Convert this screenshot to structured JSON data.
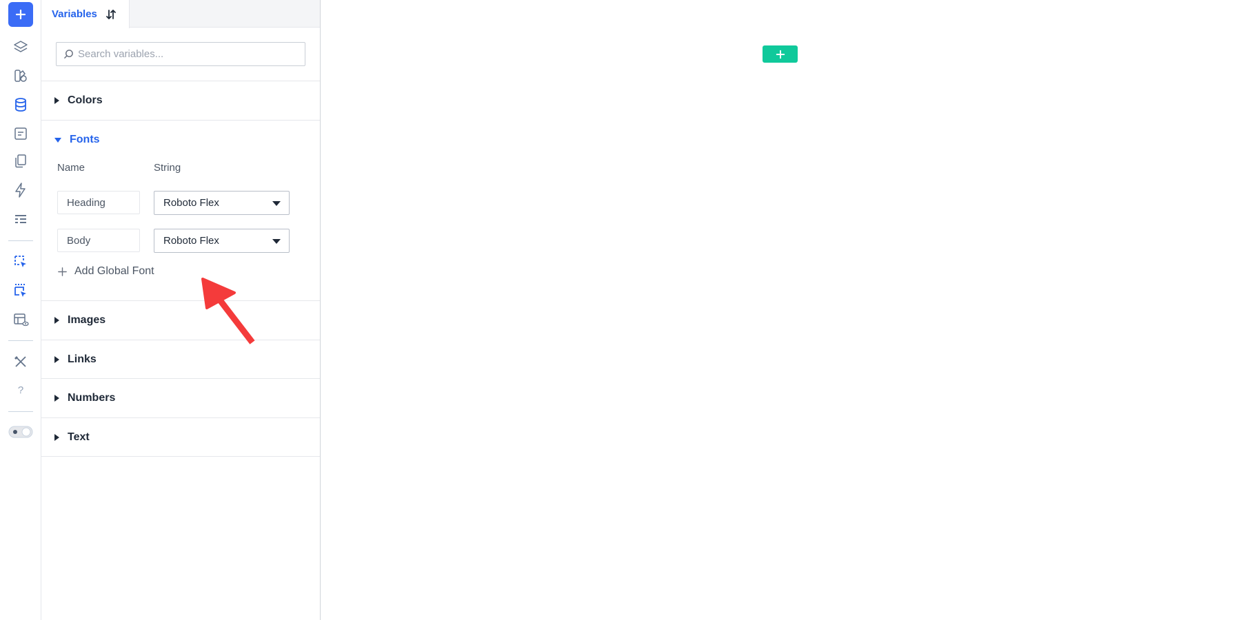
{
  "rail": {
    "add_button": "add-icon",
    "items": [
      {
        "icon": "layers-icon"
      },
      {
        "icon": "assets-icon"
      },
      {
        "icon": "database-icon",
        "active": true
      },
      {
        "icon": "form-icon"
      },
      {
        "icon": "pages-icon"
      },
      {
        "icon": "lightning-icon"
      },
      {
        "icon": "list-icon"
      },
      {
        "icon": "select-cursor-icon"
      },
      {
        "icon": "select-cursor-dots-icon"
      },
      {
        "icon": "layout-preview-icon"
      },
      {
        "icon": "tools-icon"
      },
      {
        "icon": "help-icon"
      },
      {
        "icon": "theme-toggle-icon"
      }
    ]
  },
  "panel": {
    "tab_label": "Variables",
    "tab_icon": "sort-icon",
    "search_placeholder": "Search variables...",
    "sections": {
      "colors": "Colors",
      "fonts": "Fonts",
      "images": "Images",
      "links": "Links",
      "numbers": "Numbers",
      "text": "Text"
    },
    "fonts": {
      "col_name": "Name",
      "col_type": "String",
      "rows": [
        {
          "name": "Heading",
          "value": "Roboto Flex"
        },
        {
          "name": "Body",
          "value": "Roboto Flex"
        }
      ],
      "add_label": "Add Global Font"
    }
  },
  "canvas": {
    "add_button_icon": "plus-icon"
  },
  "colors": {
    "accent": "#2563eb",
    "rail_add": "#3b6cf6",
    "canvas_add": "#10c99b",
    "annotation": "#f43b3b"
  }
}
